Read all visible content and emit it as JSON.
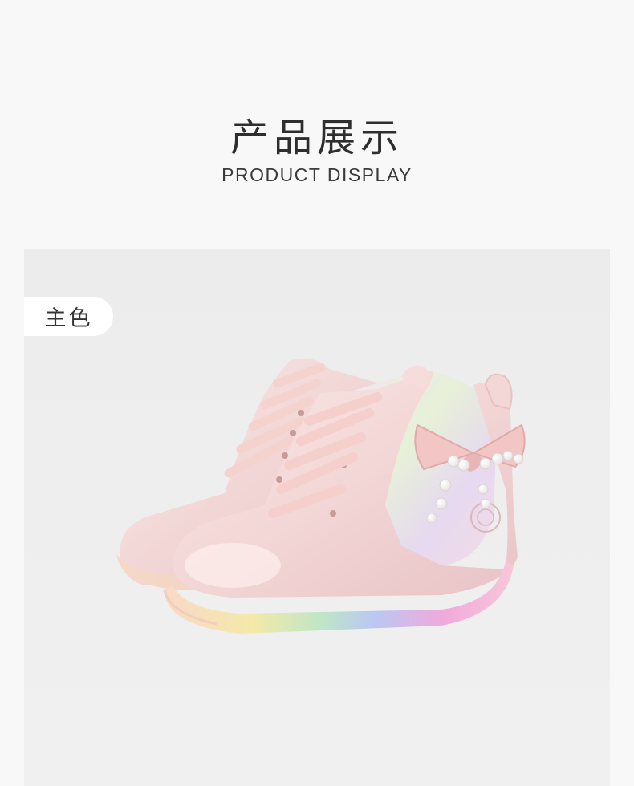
{
  "header": {
    "title_cn": "产品展示",
    "title_en": "PRODUCT DISPLAY"
  },
  "gallery": {
    "color_tag": "主色",
    "product_image": "pink-ankle-boots-with-pearl-bow-and-rainbow-light-sole"
  },
  "colors": {
    "page_background": "#f8f8f8",
    "photo_background": "#eeeeee",
    "boot_pink": "#f3d9d8",
    "tag_background": "#ffffff"
  }
}
